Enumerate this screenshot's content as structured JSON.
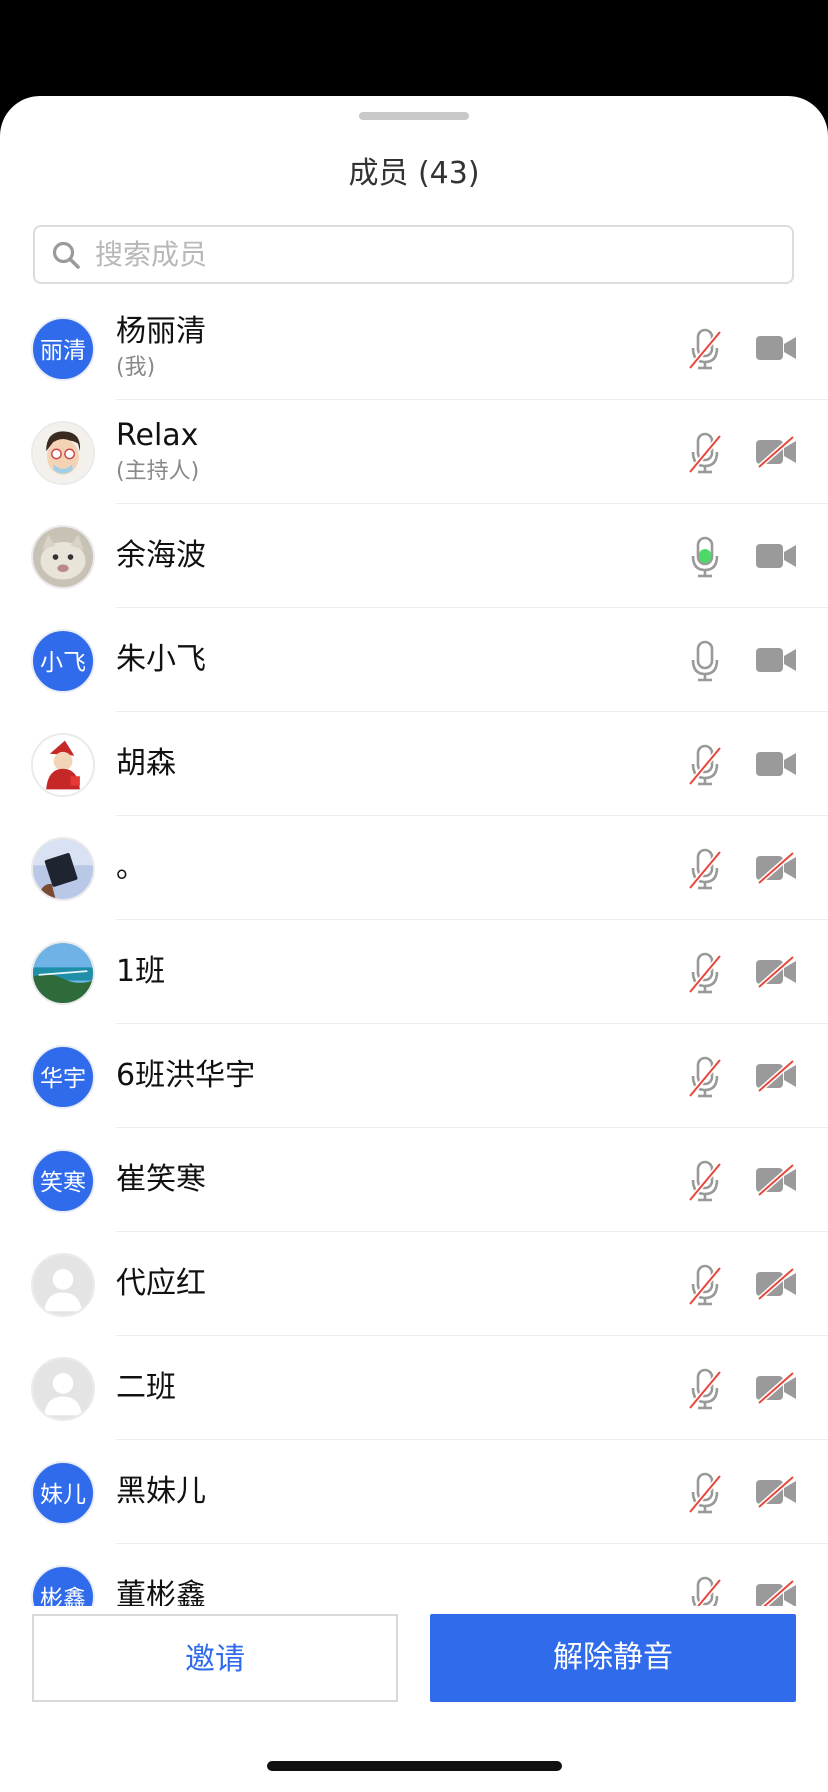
{
  "header": {
    "title": "成员 (43)"
  },
  "search": {
    "placeholder": "搜索成员",
    "icon": "search-icon"
  },
  "members": [
    {
      "name": "杨丽清",
      "sub": "(我)",
      "avatar": {
        "type": "text",
        "text": "丽清"
      },
      "mic": "muted",
      "cam": "on"
    },
    {
      "name": "Relax",
      "sub": "(主持人)",
      "avatar": {
        "type": "image",
        "name": "cartoon-avatar"
      },
      "mic": "muted",
      "cam": "off"
    },
    {
      "name": "余海波",
      "avatar": {
        "type": "image",
        "name": "cat-avatar"
      },
      "mic": "speaking",
      "cam": "on"
    },
    {
      "name": "朱小飞",
      "avatar": {
        "type": "text",
        "text": "小飞"
      },
      "mic": "on",
      "cam": "on"
    },
    {
      "name": "胡森",
      "avatar": {
        "type": "image",
        "name": "santa-avatar"
      },
      "mic": "muted",
      "cam": "on"
    },
    {
      "name": "。",
      "avatar": {
        "type": "image",
        "name": "card-avatar"
      },
      "mic": "muted",
      "cam": "off"
    },
    {
      "name": "1班",
      "avatar": {
        "type": "image",
        "name": "coast-avatar"
      },
      "mic": "muted",
      "cam": "off"
    },
    {
      "name": "6班洪华宇",
      "avatar": {
        "type": "text",
        "text": "华宇"
      },
      "mic": "muted",
      "cam": "off"
    },
    {
      "name": "崔笑寒",
      "avatar": {
        "type": "text",
        "text": "笑寒"
      },
      "mic": "muted",
      "cam": "off"
    },
    {
      "name": "代应红",
      "avatar": {
        "type": "image",
        "name": "default-person-avatar"
      },
      "mic": "muted",
      "cam": "off"
    },
    {
      "name": "二班",
      "avatar": {
        "type": "image",
        "name": "default-person-avatar"
      },
      "mic": "muted",
      "cam": "off"
    },
    {
      "name": "黑妹儿",
      "avatar": {
        "type": "text",
        "text": "妹儿"
      },
      "mic": "muted",
      "cam": "off"
    },
    {
      "name": "董彬鑫",
      "avatar": {
        "type": "text",
        "text": "彬鑫"
      },
      "mic": "muted",
      "cam": "off"
    }
  ],
  "footer": {
    "invite_label": "邀请",
    "unmute_label": "解除静音"
  },
  "colors": {
    "accent": "#2f6bea",
    "icon_gray": "#9a9a9a",
    "muted_slash": "#e8463c",
    "speaking_green": "#4cd964"
  }
}
